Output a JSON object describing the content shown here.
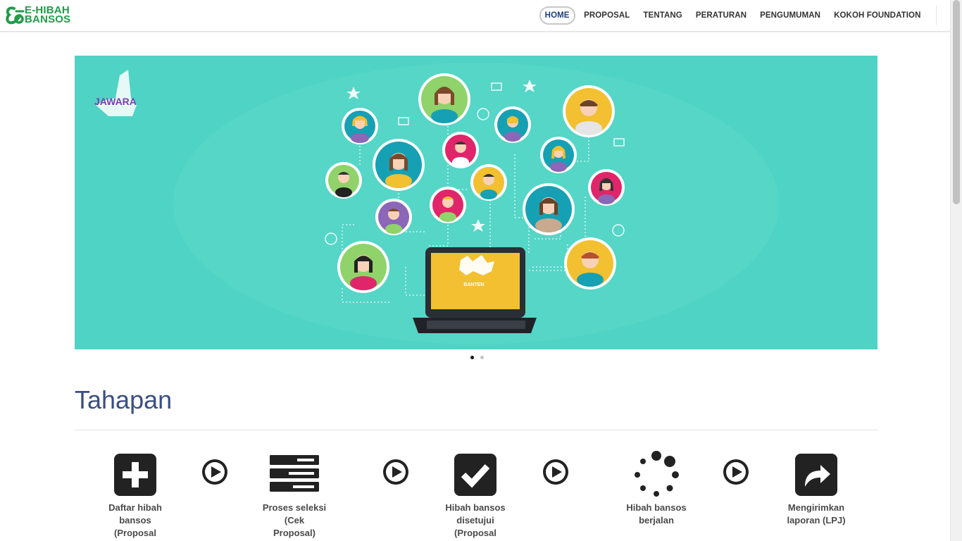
{
  "brand": {
    "line1": "E-HIBAH",
    "line2": "BANSOS"
  },
  "nav": [
    {
      "label": "HOME",
      "active": true
    },
    {
      "label": "PROPOSAL"
    },
    {
      "label": "TENTANG"
    },
    {
      "label": "PERATURAN"
    },
    {
      "label": "PENGUMUMAN"
    },
    {
      "label": "KOKOH FOUNDATION"
    }
  ],
  "hero": {
    "logo_text": "JAWARA",
    "laptop_text": "BANTEN",
    "slides": 2,
    "active_slide": 1
  },
  "section": {
    "title": "Tahapan"
  },
  "steps": [
    {
      "label_lines": [
        "Daftar hibah",
        "bansos",
        "(Proposal"
      ],
      "icon": "plus-square-icon"
    },
    {
      "label_lines": [
        "Proses seleksi",
        "(Cek",
        "Proposal)"
      ],
      "icon": "server-icon"
    },
    {
      "label_lines": [
        "Hibah bansos",
        "disetujui",
        "(Proposal"
      ],
      "icon": "check-square-icon"
    },
    {
      "label_lines": [
        "Hibah bansos",
        "berjalan"
      ],
      "icon": "spinner-icon"
    },
    {
      "label_lines": [
        "Mengirimkan",
        "laporan (LPJ)"
      ],
      "icon": "share-square-icon"
    }
  ],
  "colors": {
    "brand_green": "#1f9c4a",
    "hero_bg": "#4fd3c4",
    "title_blue": "#3b4e82",
    "active_nav": "#1f3f7a"
  }
}
